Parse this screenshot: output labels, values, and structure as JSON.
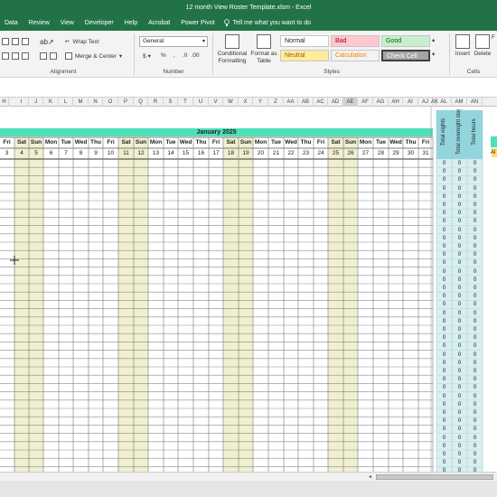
{
  "window": {
    "title": "12 month View Roster Template.xlsm  -  Excel"
  },
  "ribbon_tabs": [
    "Data",
    "Review",
    "View",
    "Developer",
    "Help",
    "Acrobat",
    "Power Pivot"
  ],
  "tell_me": "Tell me what you want to do",
  "alignment": {
    "wrap_text": "Wrap Text",
    "merge_center": "Merge & Center",
    "label": "Alignment"
  },
  "number": {
    "format": "General",
    "currency": "$",
    "percent": "%",
    "comma": ",",
    "label": "Number"
  },
  "styles": {
    "conditional": "Conditional Formatting",
    "format_table": "Format as Table",
    "normal": "Normal",
    "bad": "Bad",
    "good": "Good",
    "neutral": "Neutral",
    "calculation": "Calculation",
    "check_cell": "Check Cell",
    "label": "Styles",
    "colors": {
      "bad_bg": "#ffc7ce",
      "bad_fg": "#9c0006",
      "good_bg": "#c6efce",
      "good_fg": "#006100",
      "neutral_bg": "#ffeb9c",
      "neutral_fg": "#9c5700",
      "calc_fg": "#fa7d00",
      "check_bg": "#a5a5a5"
    }
  },
  "cells": {
    "insert": "Insert",
    "delete": "Delete",
    "format": "F",
    "label": "Cells"
  },
  "column_headers": [
    "H",
    "I",
    "J",
    "K",
    "L",
    "M",
    "N",
    "O",
    "P",
    "Q",
    "R",
    "S",
    "T",
    "U",
    "V",
    "W",
    "X",
    "Y",
    "Z",
    "AA",
    "AB",
    "AC",
    "AD",
    "AE",
    "AF",
    "AG",
    "AH",
    "AI",
    "AJ",
    "AK",
    "AL",
    "AM",
    "AN"
  ],
  "selected_column": "AE",
  "calendar": {
    "month_title": "January 2025",
    "days": [
      "Fri",
      "Sat",
      "Sun",
      "Mon",
      "Tue",
      "Wed",
      "Thu",
      "Fri",
      "Sat",
      "Sun",
      "Mon",
      "Tue",
      "Wed",
      "Thu",
      "Fri",
      "Sat",
      "Sun",
      "Mon",
      "Tue",
      "Wed",
      "Thu",
      "Fri",
      "Sat",
      "Sun",
      "Mon",
      "Tue",
      "Wed",
      "Thu",
      "Fri"
    ],
    "dates": [
      "3",
      "4",
      "5",
      "6",
      "7",
      "8",
      "9",
      "10",
      "11",
      "12",
      "13",
      "14",
      "15",
      "16",
      "17",
      "18",
      "19",
      "20",
      "21",
      "22",
      "23",
      "24",
      "25",
      "26",
      "27",
      "28",
      "29",
      "30",
      "31"
    ],
    "weekend_color": "#f0efd0",
    "header_color": "#4ee0b8"
  },
  "totals": {
    "col1_header": "Total nights",
    "col2_header": "Total overnight stays",
    "col3_header": "Total hours",
    "value": "0",
    "header_color": "#92d5dd",
    "cell_color": "#daeff1"
  },
  "side_label": "Al"
}
